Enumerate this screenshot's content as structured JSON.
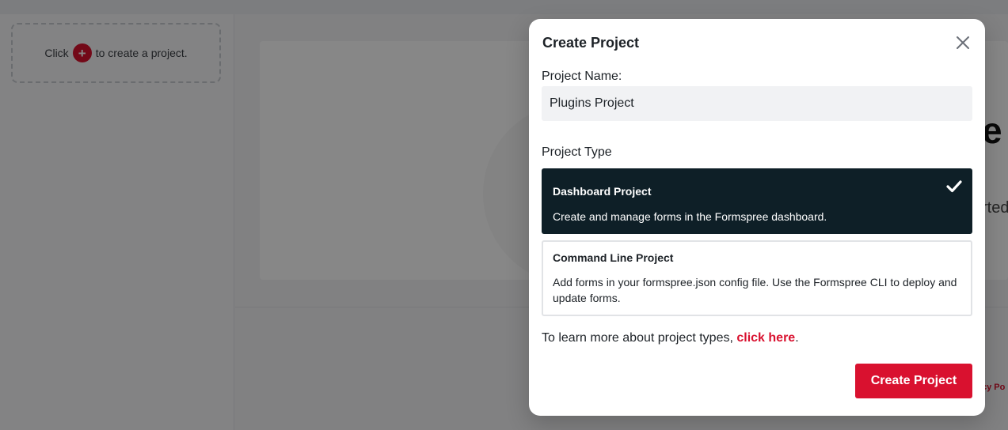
{
  "background": {
    "sidebar_hint_before": "Click",
    "sidebar_hint_after": "to create a project.",
    "hero_partial_title": "e",
    "hero_partial_sub": "rted",
    "footer_partial_link": "cy Po"
  },
  "modal": {
    "title": "Create Project",
    "project_name_label": "Project Name:",
    "project_name_value": "Plugins Project",
    "project_type_label": "Project Type",
    "options": [
      {
        "title": "Dashboard Project",
        "description": "Create and manage forms in the Formspree dashboard.",
        "selected": true
      },
      {
        "title": "Command Line Project",
        "description": "Add forms in your formspree.json config file. Use the Formspree CLI to deploy and update forms.",
        "selected": false
      }
    ],
    "learn_more_text": "To learn more about project types,",
    "learn_more_link": "click here",
    "learn_more_end": ".",
    "submit_label": "Create Project"
  },
  "colors": {
    "accent": "#d9112f",
    "selected_bg": "#0e1f27",
    "input_bg": "#f1f2f4"
  },
  "icons": {
    "close": "close-icon",
    "check": "check-icon",
    "add": "plus-icon"
  }
}
